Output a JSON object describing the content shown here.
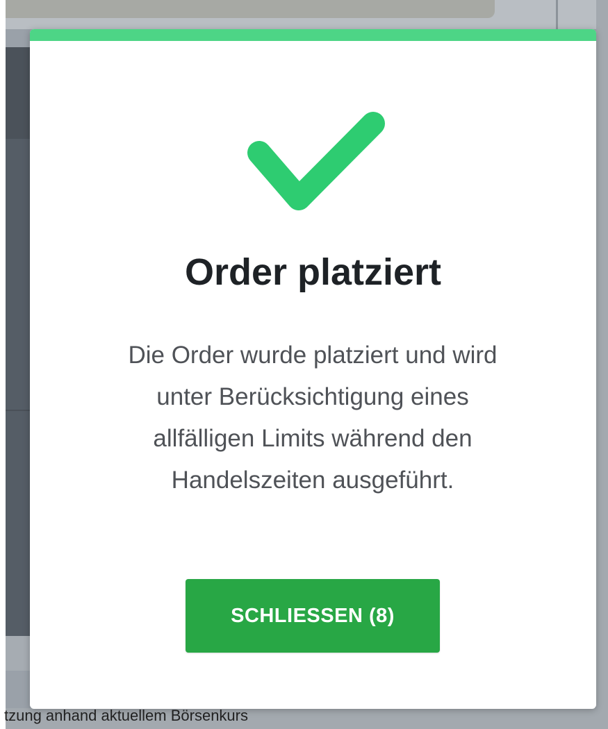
{
  "background": {
    "footer_text": "tzung anhand aktuellem Börsenkurs"
  },
  "modal": {
    "accent_color": "#4dd586",
    "icon": "checkmark-icon",
    "icon_color": "#2ecc71",
    "title": "Order platziert",
    "message": "Die Order wurde platziert und wird unter Berücksichtigung eines allfälligen Limits während den Handelszeiten ausgeführt.",
    "close_button_label": "SCHLIESSEN (8)",
    "close_button_color": "#28a745"
  }
}
